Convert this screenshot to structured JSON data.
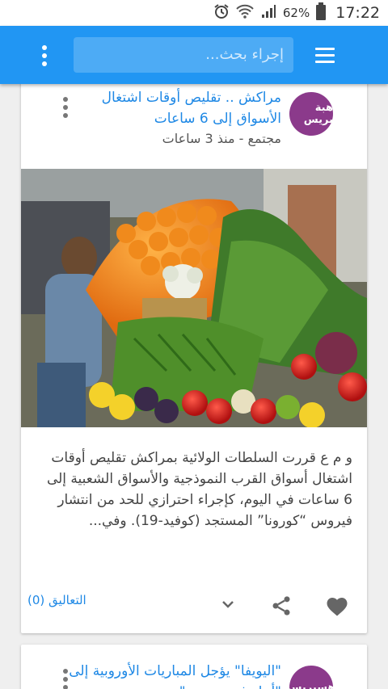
{
  "status_bar": {
    "battery_percent": "62%",
    "time": "17:22",
    "icons": [
      "alarm-icon",
      "wifi-icon",
      "signal-icon",
      "battery-icon"
    ]
  },
  "app_bar": {
    "search_placeholder": "إجراء بحث...",
    "color": "#2196f3"
  },
  "articles": [
    {
      "source_badge": "هبة بريس",
      "title": "مراكش .. تقليص أوقات اشتغال الأسواق إلى 6 ساعات",
      "meta": "مجتمع - منذ 3 ساعات",
      "excerpt": "و م ع قررت السلطات الولائية بمراكش تقليص أوقات اشتغال أسواق القرب النموذجية والأسواق الشعبية إلى 6 ساعات في اليوم، كإجراء احترازي للحد من انتشار فيروس “كورونا” المستجد (كوفيد-19). وفي...",
      "comments_label": "التعاليق (0)"
    },
    {
      "source_badge": "هسبريس",
      "title": "\"اليويفا\" يؤجل المباريات الأوروبية إلى \"أجل غير مسمى\""
    }
  ],
  "colors": {
    "link": "#1e88e5",
    "badge": "#8b3a8b"
  }
}
